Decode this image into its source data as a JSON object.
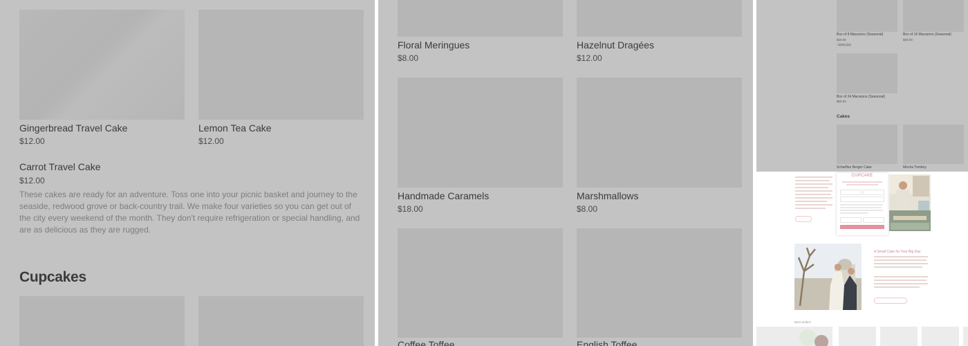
{
  "panel_left": {
    "items_top": [
      {
        "name": "Gingerbread Travel Cake",
        "price": "$12.00"
      },
      {
        "name": "Lemon Tea Cake",
        "price": "$12.00"
      }
    ],
    "featured": {
      "name": "Carrot Travel Cake",
      "price": "$12.00",
      "description": "These cakes are ready for an adventure. Toss one into your picnic basket and journey to the seaside, redwood grove or back-country trail. We make four varieties so you can get out of the city every weekend of the month. They don't require refrigeration or special handling, and are as delicious as they are rugged."
    },
    "section_heading": "Cupcakes"
  },
  "panel_middle": {
    "items": [
      {
        "name": "Floral Meringues",
        "price": "$8.00"
      },
      {
        "name": "Hazelnut Dragées",
        "price": "$12.00"
      },
      {
        "name": "Handmade Caramels",
        "price": "$18.00"
      },
      {
        "name": "Marshmallows",
        "price": "$8.00"
      },
      {
        "name": "Coffee Toffee",
        "price": ""
      },
      {
        "name": "English Toffee",
        "price": ""
      }
    ]
  },
  "panel_right": {
    "macarons": [
      {
        "name": "Box of 8 Macarons (Seasonal)",
        "price": "$20.00",
        "badge": "100% (10)"
      },
      {
        "name": "Box of 16 Macarons (Seasonal)",
        "price": "$40.00"
      },
      {
        "name": "Box of 24 Macarons (Seasonal)",
        "price": "$60.00"
      }
    ],
    "cakes_heading": "Cakes",
    "cakes": [
      {
        "name": "Scharffen Berger Cake"
      },
      {
        "name": "Mocha Tomboy"
      }
    ],
    "modal_title": "CUPCAKE",
    "wedding_heading": "A Small Cake for Your Big Day",
    "best_sellers": "Best Sellers"
  },
  "colors": {
    "dim_overlay": "#c3c3c3",
    "placeholder": "#b6b6b6",
    "accent_pink": "#e390a1"
  }
}
